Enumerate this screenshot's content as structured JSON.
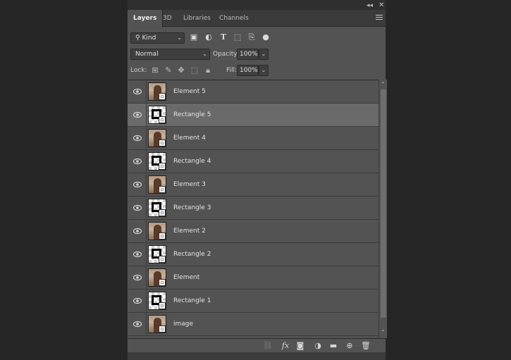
{
  "tabs": [
    {
      "label": "Layers",
      "active": true
    },
    {
      "label": "3D"
    },
    {
      "label": "Libraries"
    },
    {
      "label": "Channels"
    }
  ],
  "filter": {
    "kind_label": "Kind",
    "icons": [
      "image-filter-icon",
      "adjustment-filter-icon",
      "type-filter-icon",
      "shape-filter-icon",
      "smart-object-filter-icon",
      "filter-toggle-icon"
    ]
  },
  "blend": {
    "mode": "Normal",
    "opacity_label": "Opacity:",
    "opacity_value": "100%"
  },
  "lock": {
    "label": "Lock:",
    "icons": [
      "lock-transparent-icon",
      "lock-image-icon",
      "lock-position-icon",
      "lock-artboard-icon",
      "lock-all-icon"
    ],
    "fill_label": "Fill:",
    "fill_value": "100%"
  },
  "layers": [
    {
      "name": "Element 5",
      "type": "photo",
      "selected": false
    },
    {
      "name": "Rectangle 5",
      "type": "shape",
      "selected": true
    },
    {
      "name": "Element 4",
      "type": "photo",
      "selected": false
    },
    {
      "name": "Rectangle 4",
      "type": "shape",
      "selected": false
    },
    {
      "name": "Element 3",
      "type": "photo",
      "selected": false
    },
    {
      "name": "Rectangle 3",
      "type": "shape",
      "selected": false
    },
    {
      "name": "Element 2",
      "type": "photo",
      "selected": false
    },
    {
      "name": "Rectangle 2",
      "type": "shape",
      "selected": false
    },
    {
      "name": "Element",
      "type": "photo",
      "selected": false
    },
    {
      "name": "Rectangle 1",
      "type": "shape",
      "selected": false
    },
    {
      "name": "image",
      "type": "photo",
      "selected": false
    }
  ],
  "bottom_icons": [
    "link-icon",
    "fx-icon",
    "mask-icon",
    "adjustment-icon",
    "folder-icon",
    "new-layer-icon",
    "trash-icon"
  ],
  "colors": {
    "panel_bg": "#535353",
    "selected_row": "#6a6a6a",
    "tab_bar": "#3b3b3b"
  }
}
